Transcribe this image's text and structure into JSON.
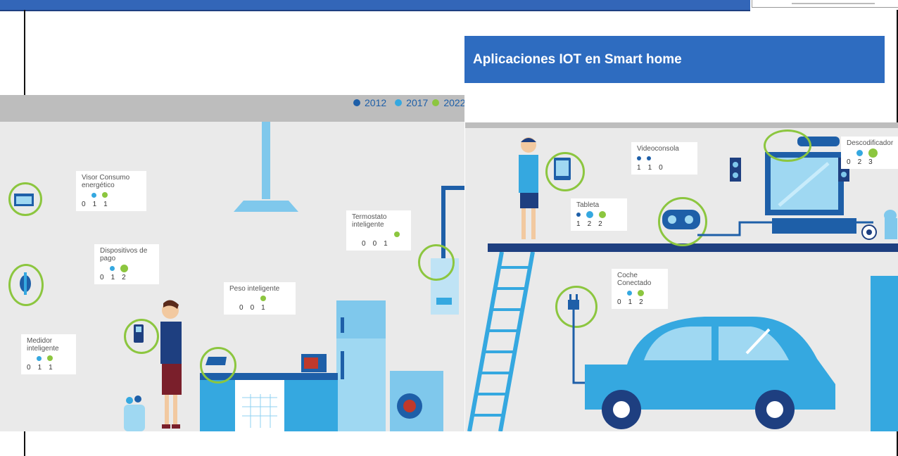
{
  "slide": {
    "title": "Aplicaciones IOT en Smart home"
  },
  "legend": {
    "items": [
      {
        "label": "2012",
        "color": "#1e5fa8"
      },
      {
        "label": "2017",
        "color": "#35a8e0"
      },
      {
        "label": "2022",
        "color": "#8cc63f"
      }
    ]
  },
  "devices": {
    "visor": {
      "label": "Visor Consumo energético",
      "values": [
        "0",
        "1",
        "1"
      ]
    },
    "dispositivos": {
      "label": "Dispositivos de pago",
      "values": [
        "0",
        "1",
        "2"
      ]
    },
    "medidor": {
      "label": "Medidor inteligente",
      "values": [
        "0",
        "1",
        "1"
      ]
    },
    "peso": {
      "label": "Peso inteligente",
      "values": [
        "0",
        "0",
        "1"
      ]
    },
    "termostato": {
      "label": "Termostato inteligente",
      "values": [
        "0",
        "0",
        "1"
      ]
    },
    "tableta": {
      "label": "Tableta",
      "values": [
        "1",
        "2",
        "2"
      ]
    },
    "videoconsola": {
      "label": "Videoconsola",
      "values": [
        "1",
        "1",
        "0"
      ]
    },
    "descodificador": {
      "label": "Descodificador",
      "values": [
        "0",
        "2",
        "3"
      ]
    },
    "coche": {
      "label": "Coche Conectado",
      "values": [
        "0",
        "1",
        "2"
      ]
    }
  }
}
